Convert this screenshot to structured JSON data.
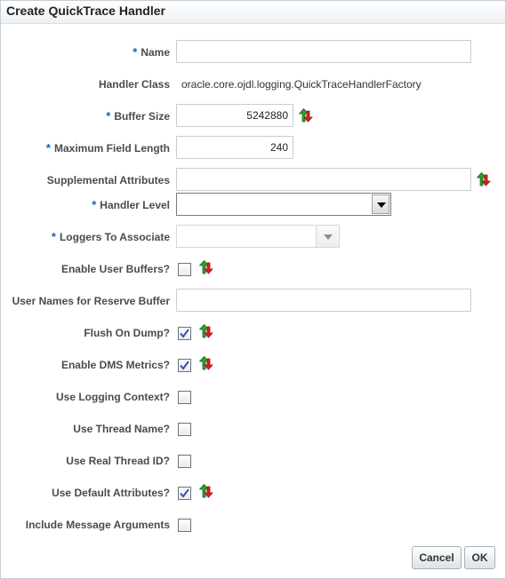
{
  "dialog": {
    "title": "Create QuickTrace Handler"
  },
  "form": {
    "name": {
      "label": "Name",
      "required": true,
      "value": ""
    },
    "handler_class": {
      "label": "Handler Class",
      "value": "oracle.core.ojdl.logging.QuickTraceHandlerFactory"
    },
    "buffer_size": {
      "label": "Buffer Size",
      "required": true,
      "value": "5242880"
    },
    "max_field_length": {
      "label": "Maximum Field Length",
      "required": true,
      "value": "240"
    },
    "supplemental_attributes": {
      "label": "Supplemental Attributes",
      "value": ""
    },
    "handler_level": {
      "label": "Handler Level",
      "required": true,
      "value": ""
    },
    "loggers_to_associate": {
      "label": "Loggers To Associate",
      "required": true,
      "value": ""
    },
    "enable_user_buffers": {
      "label": "Enable User Buffers?",
      "checked": false
    },
    "user_names_reserve_buffer": {
      "label": "User Names for Reserve Buffer",
      "value": ""
    },
    "flush_on_dump": {
      "label": "Flush On Dump?",
      "checked": true
    },
    "enable_dms_metrics": {
      "label": "Enable DMS Metrics?",
      "checked": true
    },
    "use_logging_context": {
      "label": "Use Logging Context?",
      "checked": false
    },
    "use_thread_name": {
      "label": "Use Thread Name?",
      "checked": false
    },
    "use_real_thread_id": {
      "label": "Use Real Thread ID?",
      "checked": false
    },
    "use_default_attributes": {
      "label": "Use Default Attributes?",
      "checked": true
    },
    "include_message_arguments": {
      "label": "Include Message Arguments",
      "checked": false
    }
  },
  "required_marker": "*",
  "icons": {
    "reset": "reset-to-default-icon",
    "checkmark": "checkmark-icon",
    "dropdown": "chevron-down-icon"
  },
  "colors": {
    "required_star": "#1a5fb4",
    "reset_arrow_green": "#2f9e2f",
    "reset_arrow_red": "#d62222",
    "check": "#2b5aa8"
  },
  "buttons": {
    "cancel": "Cancel",
    "ok": "OK"
  }
}
